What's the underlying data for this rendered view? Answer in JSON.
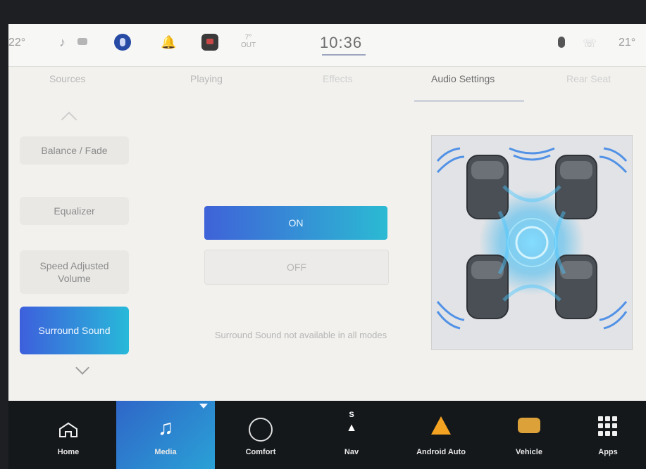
{
  "status_bar": {
    "left_temp": "22°",
    "weather_temp": "7°",
    "weather_unit": "OUT",
    "time": "10:36",
    "right_temp": "21°",
    "icons": {
      "note": "music-note-icon",
      "car": "car-icon",
      "assistant": "voice-assistant-icon",
      "bell": "bell-icon",
      "app": "app-icon",
      "mic": "microphone-icon",
      "phone": "phone-icon"
    }
  },
  "tabs": [
    {
      "label": "Sources"
    },
    {
      "label": "Playing"
    },
    {
      "label": "Effects"
    },
    {
      "label": "Audio Settings"
    },
    {
      "label": "Rear Seat"
    }
  ],
  "active_tab": "Audio Settings",
  "sidebar": {
    "items": [
      {
        "label": "Balance / Fade"
      },
      {
        "label": "Equalizer"
      },
      {
        "label": "Speed Adjusted Volume"
      },
      {
        "label": "Surround Sound"
      }
    ],
    "active": "Surround Sound"
  },
  "surround": {
    "on_label": "ON",
    "off_label": "OFF",
    "selected": "ON",
    "notice": "Surround Sound not available in all modes"
  },
  "bottom_nav": {
    "items": [
      {
        "label": "Home",
        "icon": "home-icon"
      },
      {
        "label": "Media",
        "icon": "music-note-icon"
      },
      {
        "label": "Comfort",
        "icon": "climate-icon"
      },
      {
        "label": "Nav",
        "icon": "compass-icon",
        "compass_letter": "S"
      },
      {
        "label": "Android Auto",
        "icon": "android-auto-icon"
      },
      {
        "label": "Vehicle",
        "icon": "vehicle-icon"
      },
      {
        "label": "Apps",
        "icon": "apps-grid-icon"
      }
    ],
    "active": "Media"
  },
  "colors": {
    "accent_blue": "#3f62d8",
    "accent_cyan": "#2bbad3",
    "nav_bg": "#14181b"
  }
}
